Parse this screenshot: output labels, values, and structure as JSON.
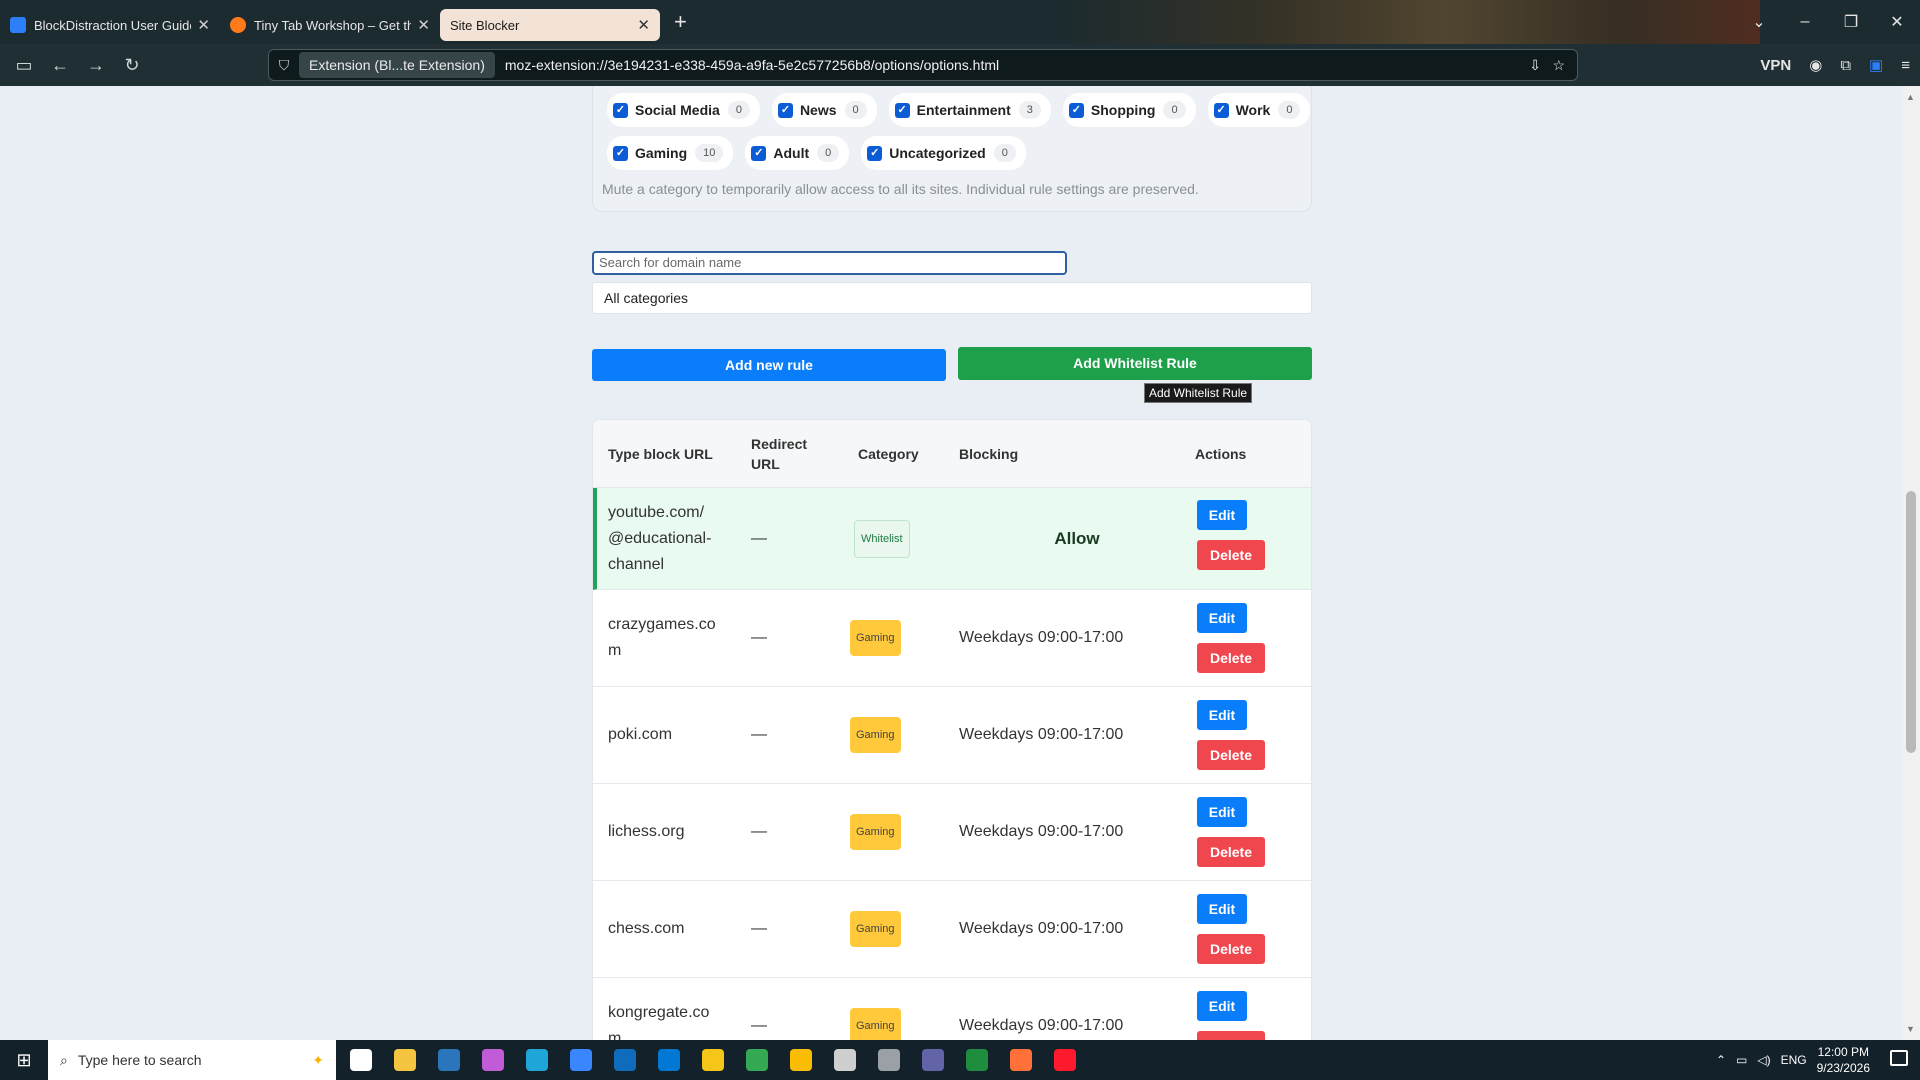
{
  "browser": {
    "tabs": [
      {
        "title": "BlockDistraction User Guide: Ru",
        "color": "#2d7ff9",
        "active": false
      },
      {
        "title": "Tiny Tab Workshop – Get this Th",
        "color": "#ff7a1a",
        "active": false
      },
      {
        "title": "Site Blocker",
        "color": "",
        "active": true
      }
    ],
    "url_identity": "Extension (Bl...te Extension)",
    "url": "moz-extension://3e194231-e338-459a-a9fa-5e2c577256b8/options/options.html",
    "vpn_label": "VPN"
  },
  "categories": {
    "row1": [
      {
        "label": "Social Media",
        "count": "0"
      },
      {
        "label": "News",
        "count": "0"
      },
      {
        "label": "Entertainment",
        "count": "3"
      },
      {
        "label": "Shopping",
        "count": "0"
      },
      {
        "label": "Work",
        "count": "0"
      }
    ],
    "row2": [
      {
        "label": "Gaming",
        "count": "10"
      },
      {
        "label": "Adult",
        "count": "0"
      },
      {
        "label": "Uncategorized",
        "count": "0"
      }
    ],
    "hint": "Mute a category to temporarily allow access to all its sites. Individual rule settings are preserved."
  },
  "filters": {
    "search_placeholder": "Search for domain name",
    "category_selected": "All categories"
  },
  "buttons": {
    "add_rule": "Add new rule",
    "add_whitelist": "Add Whitelist Rule",
    "tooltip": "Add Whitelist Rule"
  },
  "table": {
    "headers": {
      "url": "Type block URL",
      "redirect": "Redirect URL",
      "category": "Category",
      "blocking": "Blocking",
      "actions": "Actions"
    },
    "edit_label": "Edit",
    "delete_label": "Delete",
    "rows": [
      {
        "url": "youtube.com/ @educational- channel",
        "redirect": "—",
        "category": "Whitelist",
        "blocking": "Allow",
        "whitelist": true
      },
      {
        "url": "crazygames.co m",
        "redirect": "—",
        "category": "Gaming",
        "blocking": "Weekdays 09:00-17:00",
        "whitelist": false
      },
      {
        "url": "poki.com",
        "redirect": "—",
        "category": "Gaming",
        "blocking": "Weekdays 09:00-17:00",
        "whitelist": false
      },
      {
        "url": "lichess.org",
        "redirect": "—",
        "category": "Gaming",
        "blocking": "Weekdays 09:00-17:00",
        "whitelist": false
      },
      {
        "url": "chess.com",
        "redirect": "—",
        "category": "Gaming",
        "blocking": "Weekdays 09:00-17:00",
        "whitelist": false
      },
      {
        "url": "kongregate.co m",
        "redirect": "—",
        "category": "Gaming",
        "blocking": "Weekdays 09:00-17:00",
        "whitelist": false
      }
    ]
  },
  "taskbar": {
    "search_placeholder": "Type here to search",
    "lang": "ENG",
    "time": "12:00 PM",
    "date": "9/23/2026",
    "icons": [
      {
        "name": "task-view-icon",
        "color": "#ffffff"
      },
      {
        "name": "file-explorer-icon",
        "color": "#f5c542"
      },
      {
        "name": "steam-icon",
        "color": "#2a75bb"
      },
      {
        "name": "copilot-icon",
        "color": "#c25bd6"
      },
      {
        "name": "edge-icon",
        "color": "#1fa6d9"
      },
      {
        "name": "store-icon",
        "color": "#3a86ff"
      },
      {
        "name": "outlook-icon",
        "color": "#0f6cbd"
      },
      {
        "name": "vscode-icon",
        "color": "#0078d4"
      },
      {
        "name": "norton-icon",
        "color": "#f5c518"
      },
      {
        "name": "chrome-icon",
        "color": "#34a853"
      },
      {
        "name": "drive-icon",
        "color": "#fbbc04"
      },
      {
        "name": "inkscape-icon",
        "color": "#cfcfcf"
      },
      {
        "name": "calculator-icon",
        "color": "#9aa0a6"
      },
      {
        "name": "teams-icon",
        "color": "#6264a7"
      },
      {
        "name": "sheets-icon",
        "color": "#1e8e3e"
      },
      {
        "name": "firefox-icon",
        "color": "#ff7139"
      },
      {
        "name": "opera-icon",
        "color": "#ff1b2d"
      }
    ]
  }
}
